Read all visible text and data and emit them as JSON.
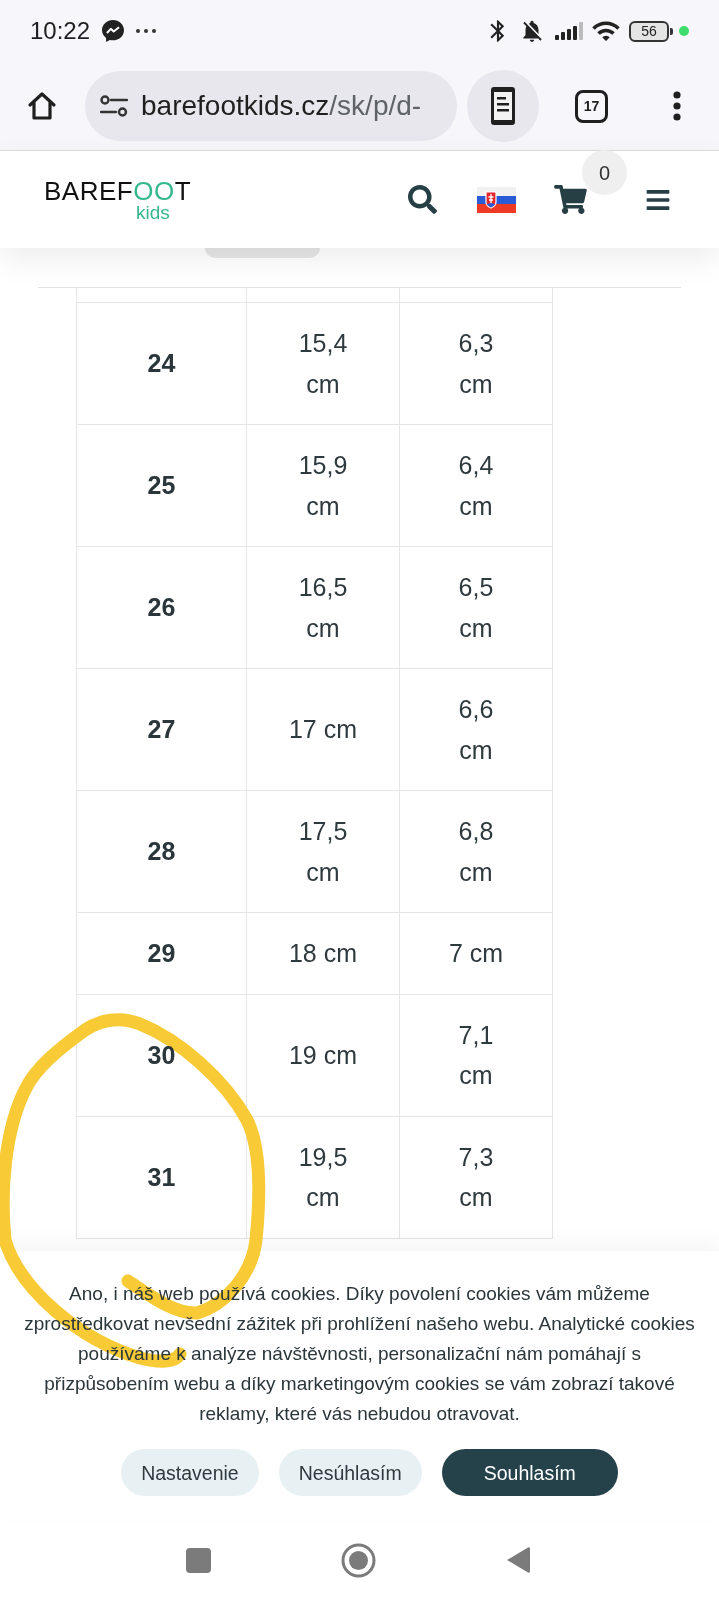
{
  "status_bar": {
    "time": "10:22",
    "battery": "56"
  },
  "browser": {
    "url_domain": "barefootkids.cz",
    "url_path": "/sk/p/d-",
    "tab_count": "17"
  },
  "site_header": {
    "logo": {
      "word": "BAREFOOT",
      "tagline": "kids"
    },
    "cart_count": "0"
  },
  "size_table": {
    "rows": [
      {
        "cells": [
          "24",
          "15,4 cm",
          "6,3 cm"
        ]
      },
      {
        "cells": [
          "25",
          "15,9 cm",
          "6,4 cm"
        ]
      },
      {
        "cells": [
          "26",
          "16,5 cm",
          "6,5 cm"
        ]
      },
      {
        "cells": [
          "27",
          "17 cm",
          "6,6 cm"
        ]
      },
      {
        "cells": [
          "28",
          "17,5 cm",
          "6,8 cm"
        ]
      },
      {
        "cells": [
          "29",
          "18 cm",
          "7 cm"
        ]
      },
      {
        "cells": [
          "30",
          "19 cm",
          "7,1 cm"
        ]
      },
      {
        "cells": [
          "31",
          "19,5 cm",
          "7,3 cm"
        ]
      }
    ]
  },
  "cookie_banner": {
    "text": "Ano, i náš web používá cookies. Díky povolení cookies vám můžeme zprostředkovat nevšední zážitek při prohlížení našeho webu. Analytické cookies používáme k analýze návštěvnosti, personalizační nám pomáhají s přizpůsobením webu a díky marketingovým cookies se vám zobrazí takové reklamy, které vás nebudou otravovat.",
    "buttons": [
      {
        "label": "Nastavenie",
        "kind": "secondary"
      },
      {
        "label": "Nesúhlasím",
        "kind": "secondary"
      },
      {
        "label": "Souhlasím",
        "kind": "primary"
      }
    ]
  }
}
